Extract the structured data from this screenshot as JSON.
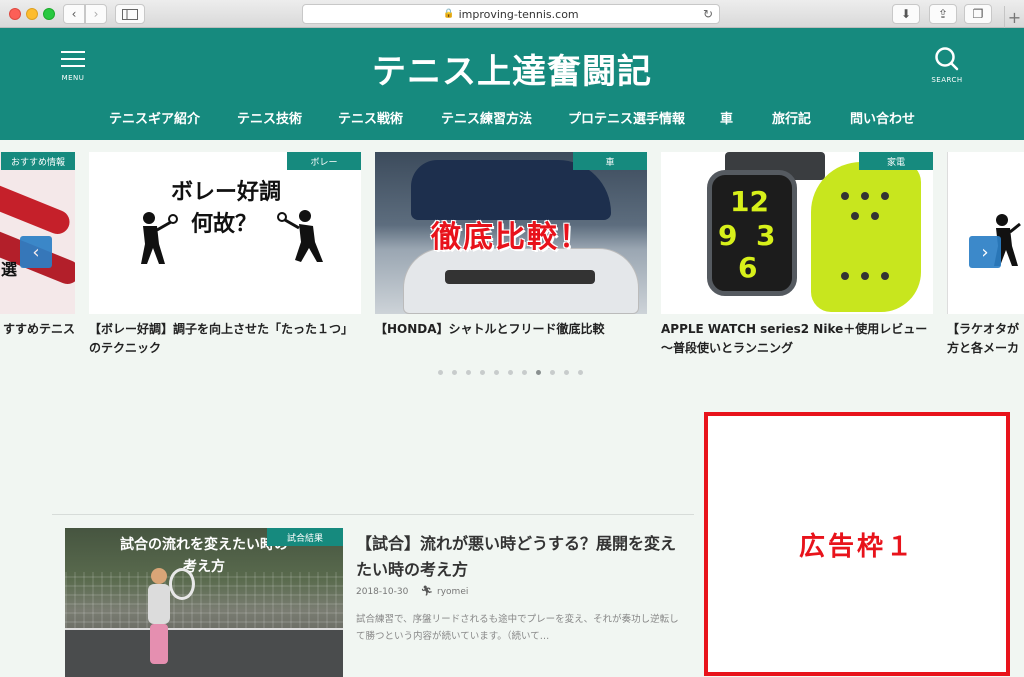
{
  "browser": {
    "url": "improving-tennis.com",
    "back_glyph": "‹",
    "forward_glyph": "›",
    "reload_glyph": "↻",
    "download_glyph": "⬇",
    "share_glyph": "⇪",
    "tabs_glyph": "❐",
    "newtab_glyph": "+"
  },
  "header": {
    "site_title": "テニス上達奮闘記",
    "menu_label": "MENU",
    "search_label": "SEARCH",
    "bg_color": "#168a7e"
  },
  "nav": {
    "items": [
      {
        "label": "テニスギア紹介"
      },
      {
        "label": "テニス技術"
      },
      {
        "label": "テニス戦術"
      },
      {
        "label": "テニス練習方法"
      },
      {
        "label": "プロテニス選手情報"
      },
      {
        "label": "車"
      },
      {
        "label": "旅行記"
      },
      {
        "label": "問い合わせ"
      }
    ]
  },
  "carousel": {
    "prev_glyph": "‹",
    "next_glyph": "›",
    "cards": [
      {
        "badge": "おすすめ情報",
        "title": "すすめテニス",
        "art_text": "選"
      },
      {
        "badge": "ボレー",
        "title": "【ボレー好調】調子を向上させた「たった１つ」のテクニック",
        "art_line1": "ボレー好調",
        "art_line2": "何故？"
      },
      {
        "badge": "車",
        "title": "【HONDA】シャトルとフリード徹底比較",
        "art_text": "徹底比較！"
      },
      {
        "badge": "家電",
        "title": "APPLE WATCH series2 Nike＋使用レビュー 〜普段使いとランニング",
        "art_num1": "12",
        "art_num2": "9",
        "art_num3": "6",
        "art_num4": "3"
      },
      {
        "badge": "",
        "title": "【ラケオタが方と各メーカ"
      }
    ],
    "dot_count": 11,
    "active_dot": 7
  },
  "ad": {
    "label": "広告枠１",
    "border_color": "#e8131b"
  },
  "article": {
    "badge": "試合結果",
    "thumb_text_line1": "試合の流れを変えたい時の",
    "thumb_text_line2": "考え方",
    "title": "【試合】流れが悪い時どうする？展開を変えたい時の考え方",
    "date": "2018-10-30",
    "author": "ryomei",
    "excerpt": "試合練習で、序盤リードされるも途中でプレーを変え、それが奏功し逆転して勝つという内容が続いています。（続いて…"
  }
}
